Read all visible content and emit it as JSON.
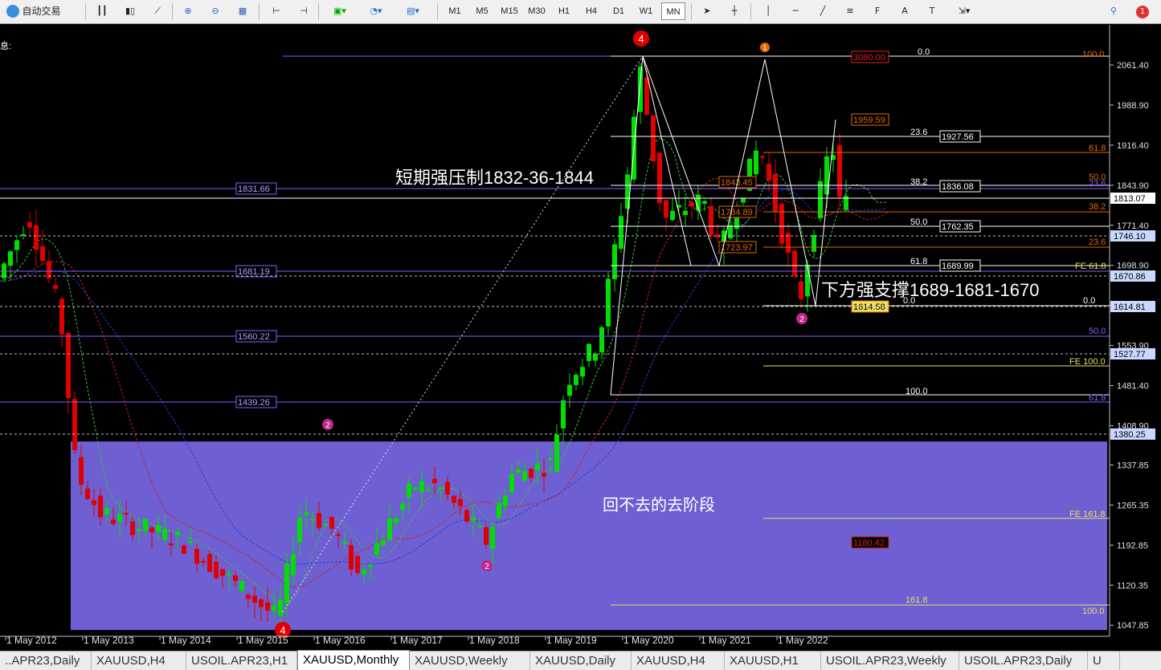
{
  "toolbar": {
    "auto_trading_label": "自动交易",
    "timeframes": [
      "M1",
      "M5",
      "M15",
      "M30",
      "H1",
      "H4",
      "D1",
      "W1",
      "MN"
    ],
    "notification_count": "1"
  },
  "chart": {
    "info_label": "息:",
    "annotations": {
      "resistance": "短期强压制1832-36-1844",
      "support": "下方强支撑1689-1681-1670",
      "zone": "回不去的去阶段"
    },
    "price_axis": [
      "2061.40",
      "1988.90",
      "1916.40",
      "1843.90",
      "1771.40",
      "1698.90",
      "1626.40",
      "1553.90",
      "1481.40",
      "1408.90",
      "1337.85",
      "1265.35",
      "1192.85",
      "1120.35",
      "1047.85"
    ],
    "time_axis": [
      "1 May 2012",
      "1 May 2013",
      "1 May 2014",
      "1 May 2015",
      "1 May 2016",
      "1 May 2017",
      "1 May 2018",
      "1 May 2019",
      "1 May 2020",
      "1 May 2021",
      "1 May 2022"
    ],
    "price_markers": [
      {
        "label": "1813.07",
        "color": "#ffffff",
        "text": "#000000"
      },
      {
        "label": "1746.10",
        "color": "#c8d8ff",
        "text": "#000000"
      },
      {
        "label": "1670.86",
        "color": "#c8d8ff",
        "text": "#000000"
      },
      {
        "label": "1614.81",
        "color": "#c8d8ff",
        "text": "#000000"
      },
      {
        "label": "1527.77",
        "color": "#c8d8ff",
        "text": "#000000"
      },
      {
        "label": "1380.25",
        "color": "#c8d8ff",
        "text": "#000000"
      }
    ],
    "level_boxes": [
      "1831.66",
      "1681.19",
      "1560.22",
      "1439.26"
    ],
    "fib_left": [
      "0.0",
      "23.6",
      "38.2",
      "50.0",
      "61.8",
      "0.0",
      "100.0"
    ],
    "fib_right": [
      "100.0",
      "61.8",
      "50.0",
      "23.6",
      "38.2",
      "23.6",
      "0.0",
      "50.0",
      "FE 100.0",
      "61.8",
      "FE 61.8",
      "FE 161.8",
      "161.8",
      "100.0"
    ],
    "fib_boxes": [
      "1927.56",
      "1836.08",
      "1762.35",
      "1689.99"
    ],
    "orange_boxes": [
      "1959.59",
      "1843.45",
      "1784.89",
      "1723.97",
      "1614.58",
      "1180.42"
    ],
    "top_label": "3080.00",
    "wave_labels": [
      "4",
      "4",
      "1",
      "2",
      "2",
      "2"
    ]
  },
  "tabs": [
    "..APR23,Daily",
    "XAUUSD,H4",
    "USOIL.APR23,H1",
    "XAUUSD,Monthly",
    "XAUUSD,Weekly",
    "XAUUSD,Daily",
    "XAUUSD,H4",
    "XAUUSD,H1",
    "USOIL.APR23,Weekly",
    "USOIL.APR23,Daily",
    "U"
  ],
  "active_tab": "XAUUSD,Monthly",
  "colors": {
    "bull": "#00e000",
    "bear": "#e00000",
    "zone": "#6e5fd2",
    "fib": "#ffffff",
    "level": "#8a5cff",
    "accent": "#e06a00"
  }
}
